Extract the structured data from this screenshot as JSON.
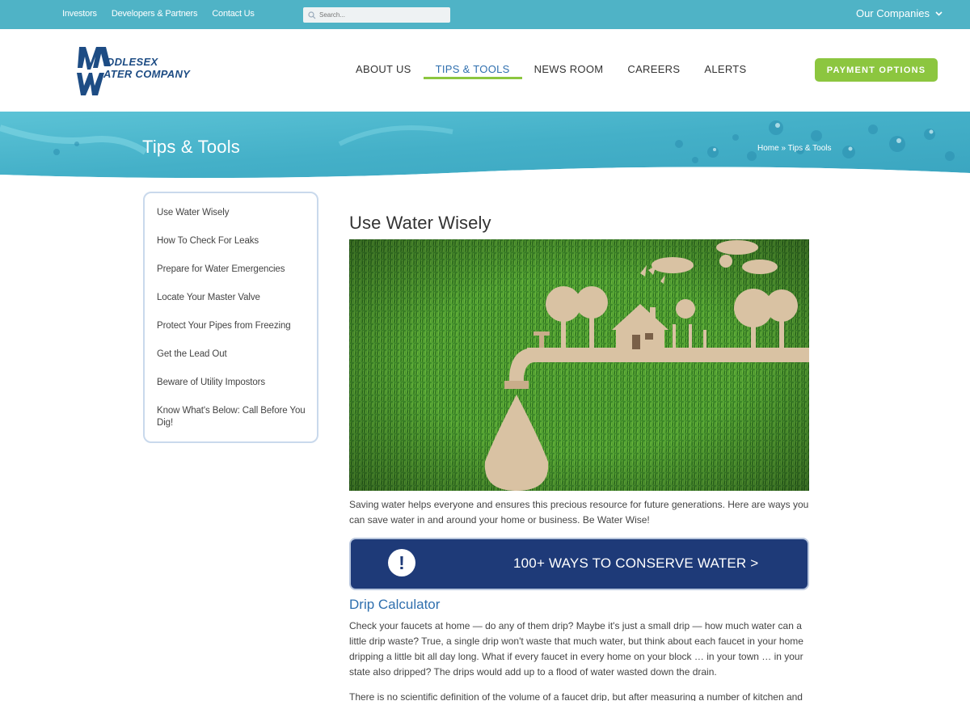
{
  "topbar": {
    "links": [
      "Investors",
      "Developers & Partners",
      "Contact Us"
    ],
    "search_placeholder": "Search...",
    "companies_label": "Our Companies"
  },
  "header": {
    "logo_line1": "IDDLESEX",
    "logo_line2": "ATER COMPANY",
    "nav": [
      "ABOUT US",
      "TIPS & TOOLS",
      "NEWS ROOM",
      "CAREERS",
      "ALERTS"
    ],
    "active_nav": "TIPS & TOOLS",
    "payment_label": "PAYMENT OPTIONS"
  },
  "hero": {
    "title": "Tips & Tools",
    "breadcrumb": "Home » Tips & Tools"
  },
  "sidebar": {
    "items": [
      "Use Water Wisely",
      "How To Check For Leaks",
      "Prepare for Water Emergencies",
      "Locate Your Master Valve",
      "Protect Your Pipes from Freezing",
      "Get the Lead Out",
      "Beware of Utility Impostors",
      "Know What's Below: Call Before You Dig!"
    ]
  },
  "main": {
    "title": "Use Water Wisely",
    "intro": "Saving water helps everyone and ensures this precious resource for future generations. Here are ways you can save water in and around your home or business. Be Water Wise!",
    "cta_icon": "!",
    "cta_label": "100+ WAYS TO CONSERVE WATER >",
    "section_title": "Drip Calculator",
    "para1": "Check your faucets at home — do any of them drip? Maybe it's just a small drip — how much water can a little drip waste? True, a single drip won't waste that much water, but think about each faucet in your home dripping a little bit all day long. What if every faucet in every home on your block … in your town … in your state also dripped? The drips would add up to a flood of water wasted down the drain.",
    "para2": "There is no scientific definition of the volume of a faucet drip, but after measuring a number of kitchen and"
  },
  "colors": {
    "topbar": "#4fb3c6",
    "brand_blue": "#1d4c84",
    "accent_green": "#8cc63f",
    "cta_blue": "#1e3a78"
  }
}
